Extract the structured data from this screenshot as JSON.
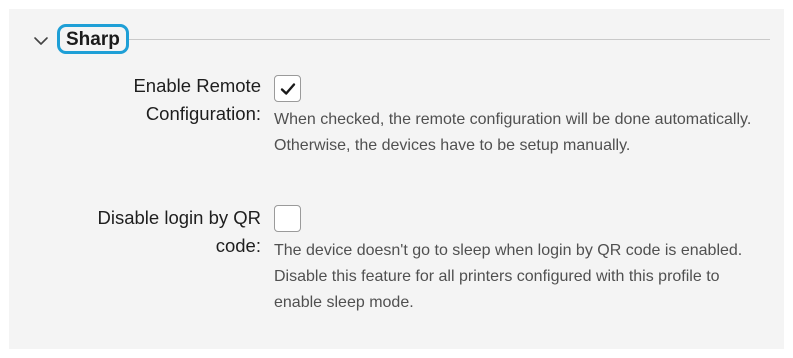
{
  "section": {
    "title": "Sharp",
    "expanded": true,
    "accent_color": "#1e9fd6",
    "chevron_icon": "chevron-down-icon"
  },
  "settings": [
    {
      "label_line1": "Enable Remote",
      "label_line2": "Configuration:",
      "checked": true,
      "description": "When checked, the remote configuration will be done automatically. Otherwise, the devices have to be setup manually."
    },
    {
      "label_line1": "Disable login by QR",
      "label_line2": "code:",
      "checked": false,
      "description": "The device doesn't go to sleep when login by QR code is enabled. Disable this feature for all printers configured with this profile to enable sleep mode."
    }
  ]
}
